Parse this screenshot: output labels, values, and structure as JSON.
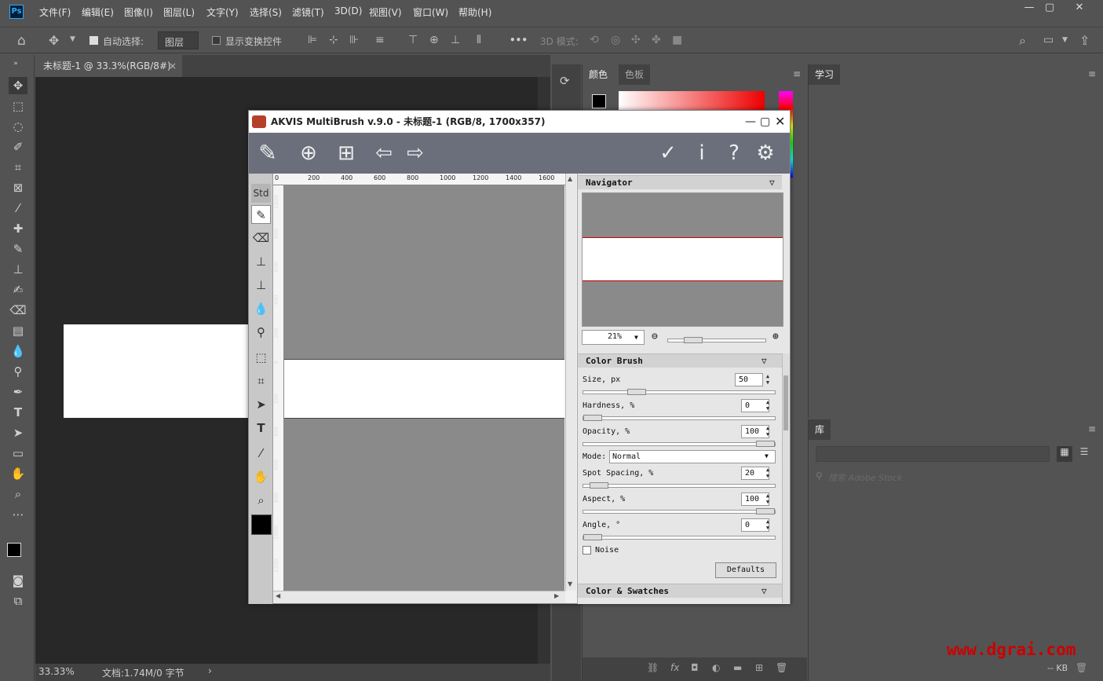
{
  "menubar": {
    "logo": "Ps",
    "items": [
      "文件(F)",
      "编辑(E)",
      "图像(I)",
      "图层(L)",
      "文字(Y)",
      "选择(S)",
      "滤镜(T)",
      "3D(D)",
      "视图(V)",
      "窗口(W)",
      "帮助(H)"
    ],
    "min": "—",
    "max": "▢",
    "close": "✕"
  },
  "options": {
    "auto_select_label": "自动选择:",
    "auto_select_value": "图层",
    "show_transform_label": "显示变换控件",
    "mode3d_label": "3D 模式:",
    "more": "•••"
  },
  "document": {
    "tab_title": "未标题-1 @ 33.3%(RGB/8#)",
    "tab_close": "×",
    "zoom": "33.33%",
    "doc_info": "文档:1.74M/0 字节",
    "arrow": "›"
  },
  "panels": {
    "color_tab": "颜色",
    "swatches_tab": "色板",
    "learn_tab": "学习",
    "library_tab": "库",
    "library_search_placeholder": "搜索 Adobe Stock",
    "kb": "-- KB"
  },
  "akvis": {
    "title": "AKVIS MultiBrush v.9.0 - 未标题-1 (RGB/8, 1700x357)",
    "std_label": "Std",
    "ruler_top": [
      "0",
      "200",
      "400",
      "600",
      "800",
      "1000",
      "1200",
      "1400",
      "1600"
    ],
    "ruler_left": [
      "1000",
      "800",
      "600",
      "400",
      "200",
      "0",
      "200",
      "400",
      "600",
      "800",
      "1000",
      "1200"
    ],
    "navigator": {
      "title": "Navigator",
      "zoom": "21%"
    },
    "color_brush": {
      "title": "Color Brush",
      "size_label": "Size, px",
      "size": "50",
      "hardness_label": "Hardness, %",
      "hardness": "0",
      "opacity_label": "Opacity, %",
      "opacity": "100",
      "mode_label": "Mode:",
      "mode": "Normal",
      "spacing_label": "Spot Spacing, %",
      "spacing": "20",
      "aspect_label": "Aspect, %",
      "aspect": "100",
      "angle_label": "Angle, °",
      "angle": "0",
      "noise_label": "Noise",
      "defaults_label": "Defaults"
    },
    "swatches_title": "Color & Swatches"
  },
  "watermark": "www.dgrai.com",
  "colors": {
    "accent_red": "#cc0000",
    "ps_blue": "#31a8ff"
  }
}
